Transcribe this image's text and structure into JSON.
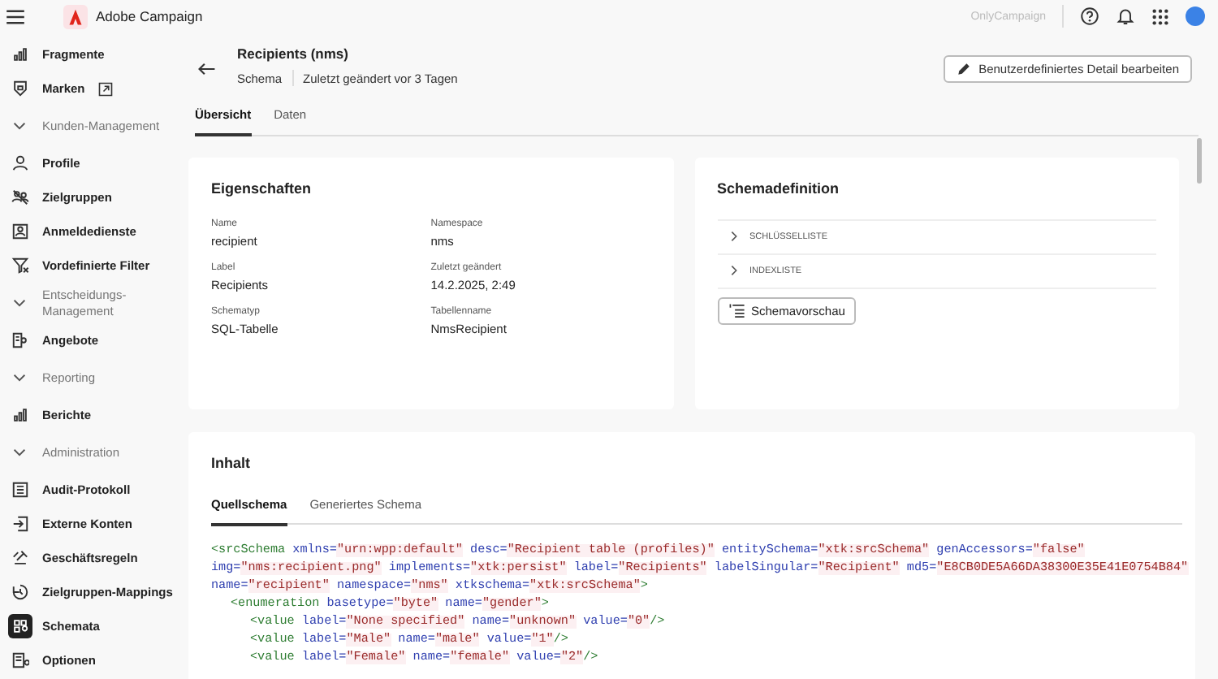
{
  "app": {
    "title": "Adobe Campaign",
    "org": "OnlyCampaign"
  },
  "sidebar": {
    "items": [
      {
        "kind": "item",
        "label": "Fragmente",
        "selected": false
      },
      {
        "kind": "item",
        "label": "Marken",
        "selected": false,
        "external": true
      },
      {
        "kind": "section",
        "label": "Kunden-Management",
        "expanded": true
      },
      {
        "kind": "item",
        "label": "Profile",
        "selected": false
      },
      {
        "kind": "item",
        "label": "Zielgruppen",
        "selected": false
      },
      {
        "kind": "item",
        "label": "Anmeldedienste",
        "selected": false
      },
      {
        "kind": "item",
        "label": "Vordefinierte Filter",
        "selected": false
      },
      {
        "kind": "section",
        "label": "Entscheidungs-Management",
        "expanded": true
      },
      {
        "kind": "item",
        "label": "Angebote",
        "selected": false
      },
      {
        "kind": "section",
        "label": "Reporting",
        "expanded": true
      },
      {
        "kind": "item",
        "label": "Berichte",
        "selected": false
      },
      {
        "kind": "section",
        "label": "Administration",
        "expanded": true
      },
      {
        "kind": "item",
        "label": "Audit-Protokoll",
        "selected": false
      },
      {
        "kind": "item",
        "label": "Externe Konten",
        "selected": false
      },
      {
        "kind": "item",
        "label": "Geschäftsregeln",
        "selected": false
      },
      {
        "kind": "item",
        "label": "Zielgruppen-Mappings",
        "selected": false
      },
      {
        "kind": "item",
        "label": "Schemata",
        "selected": true
      },
      {
        "kind": "item",
        "label": "Optionen",
        "selected": false
      }
    ]
  },
  "page": {
    "title": "Recipients (nms)",
    "type": "Schema",
    "modified": "Zuletzt geändert vor 3 Tagen",
    "edit_button": "Benutzerdefiniertes Detail bearbeiten"
  },
  "tabs": [
    {
      "label": "Übersicht",
      "selected": true
    },
    {
      "label": "Daten",
      "selected": false
    }
  ],
  "properties": {
    "title": "Eigenschaften",
    "fields": [
      {
        "label": "Name",
        "value": "recipient"
      },
      {
        "label": "Namespace",
        "value": "nms"
      },
      {
        "label": "Label",
        "value": "Recipients"
      },
      {
        "label": "Zuletzt geändert",
        "value": "14.2.2025, 2:49"
      },
      {
        "label": "Schematyp",
        "value": "SQL-Tabelle"
      },
      {
        "label": "Tabellenname",
        "value": "NmsRecipient"
      }
    ]
  },
  "schema_definition": {
    "title": "Schemadefinition",
    "sections": [
      {
        "label": "SCHLÜSSELLISTE",
        "expanded": false
      },
      {
        "label": "INDEXLISTE",
        "expanded": false
      }
    ],
    "preview_button": "Schemavorschau"
  },
  "content": {
    "title": "Inhalt",
    "tabs": [
      {
        "label": "Quellschema",
        "selected": true
      },
      {
        "label": "Generiertes Schema",
        "selected": false
      }
    ],
    "code": [
      {
        "rows": [
          {
            "tokens": [
              {
                "kind": "tag",
                "text": "<srcSchema"
              },
              {
                "kind": "attr",
                "text": " xmlns="
              },
              {
                "kind": "value",
                "text": "\"urn:wpp:default\""
              },
              {
                "kind": "attr",
                "text": " desc="
              },
              {
                "kind": "value",
                "text": "\"Recipient table (profiles)\""
              },
              {
                "kind": "attr",
                "text": " entitySchema="
              },
              {
                "kind": "value",
                "text": "\"xtk:srcSchema\""
              },
              {
                "kind": "attr",
                "text": " genAccessors="
              },
              {
                "kind": "value",
                "text": "\"false\""
              }
            ]
          },
          {
            "tokens": [
              {
                "kind": "attr",
                "text": "img="
              },
              {
                "kind": "value",
                "text": "\"nms:recipient.png\""
              },
              {
                "kind": "attr",
                "text": " implements="
              },
              {
                "kind": "value",
                "text": "\"xtk:persist\""
              },
              {
                "kind": "attr",
                "text": " label="
              },
              {
                "kind": "value",
                "text": "\"Recipients\""
              },
              {
                "kind": "attr",
                "text": " labelSingular="
              },
              {
                "kind": "value",
                "text": "\"Recipient\""
              },
              {
                "kind": "attr",
                "text": " md5="
              },
              {
                "kind": "value",
                "text": "\"E8CB0DE5A66DA38300E35E41E0754B84\""
              }
            ]
          },
          {
            "tokens": [
              {
                "kind": "attr",
                "text": "name="
              },
              {
                "kind": "value",
                "text": "\"recipient\""
              },
              {
                "kind": "attr",
                "text": " namespace="
              },
              {
                "kind": "value",
                "text": "\"nms\""
              },
              {
                "kind": "attr",
                "text": " xtkschema="
              },
              {
                "kind": "value",
                "text": "\"xtk:srcSchema\""
              },
              {
                "kind": "tag",
                "text": ">"
              }
            ]
          }
        ],
        "children": [
          {
            "rows": [
              {
                "tokens": [
                  {
                    "kind": "tag",
                    "text": "<enumeration"
                  },
                  {
                    "kind": "attr",
                    "text": " basetype="
                  },
                  {
                    "kind": "value",
                    "text": "\"byte\""
                  },
                  {
                    "kind": "attr",
                    "text": " name="
                  },
                  {
                    "kind": "value",
                    "text": "\"gender\""
                  },
                  {
                    "kind": "tag",
                    "text": ">"
                  }
                ]
              }
            ],
            "children": [
              {
                "rows": [
                  {
                    "tokens": [
                      {
                        "kind": "tag",
                        "text": "<value"
                      },
                      {
                        "kind": "attr",
                        "text": " label="
                      },
                      {
                        "kind": "value",
                        "text": "\"None specified\""
                      },
                      {
                        "kind": "attr",
                        "text": " name="
                      },
                      {
                        "kind": "value",
                        "text": "\"unknown\""
                      },
                      {
                        "kind": "attr",
                        "text": " value="
                      },
                      {
                        "kind": "value",
                        "text": "\"0\""
                      },
                      {
                        "kind": "tag",
                        "text": "/>"
                      }
                    ]
                  }
                ]
              },
              {
                "rows": [
                  {
                    "tokens": [
                      {
                        "kind": "tag",
                        "text": "<value"
                      },
                      {
                        "kind": "attr",
                        "text": " label="
                      },
                      {
                        "kind": "value",
                        "text": "\"Male\""
                      },
                      {
                        "kind": "attr",
                        "text": " name="
                      },
                      {
                        "kind": "value",
                        "text": "\"male\""
                      },
                      {
                        "kind": "attr",
                        "text": " value="
                      },
                      {
                        "kind": "value",
                        "text": "\"1\""
                      },
                      {
                        "kind": "tag",
                        "text": "/>"
                      }
                    ]
                  }
                ]
              },
              {
                "rows": [
                  {
                    "tokens": [
                      {
                        "kind": "tag",
                        "text": "<value"
                      },
                      {
                        "kind": "attr",
                        "text": " label="
                      },
                      {
                        "kind": "value",
                        "text": "\"Female\""
                      },
                      {
                        "kind": "attr",
                        "text": " name="
                      },
                      {
                        "kind": "value",
                        "text": "\"female\""
                      },
                      {
                        "kind": "attr",
                        "text": " value="
                      },
                      {
                        "kind": "value",
                        "text": "\"2\""
                      },
                      {
                        "kind": "tag",
                        "text": "/>"
                      }
                    ]
                  }
                ]
              }
            ]
          }
        ]
      }
    ]
  }
}
